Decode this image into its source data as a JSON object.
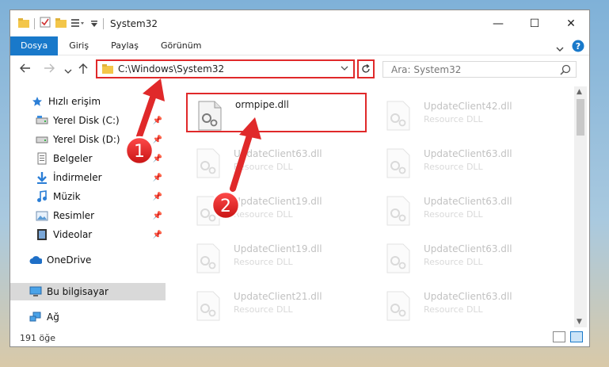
{
  "title_bar": {
    "title": "System32",
    "minimize": "—",
    "maximize": "☐",
    "close": "✕"
  },
  "ribbon": {
    "tabs": [
      "Dosya",
      "Giriş",
      "Paylaş",
      "Görünüm"
    ],
    "help": "?"
  },
  "address": {
    "path": "C:\\Windows\\System32",
    "search_placeholder": "Ara: System32"
  },
  "sidebar": {
    "items": [
      {
        "label": "Hızlı erişim",
        "icon": "star-icon",
        "pinned": false
      },
      {
        "label": "Yerel Disk (C:)",
        "icon": "drive-icon",
        "pinned": true
      },
      {
        "label": "Yerel Disk (D:)",
        "icon": "drive-icon",
        "pinned": true
      },
      {
        "label": "Belgeler",
        "icon": "documents-icon",
        "pinned": true
      },
      {
        "label": "İndirmeler",
        "icon": "download-icon",
        "pinned": true
      },
      {
        "label": "Müzik",
        "icon": "music-icon",
        "pinned": true
      },
      {
        "label": "Resimler",
        "icon": "pictures-icon",
        "pinned": true
      },
      {
        "label": "Videolar",
        "icon": "videos-icon",
        "pinned": true
      },
      {
        "label": "OneDrive",
        "icon": "cloud-icon",
        "pinned": false
      },
      {
        "label": "Bu bilgisayar",
        "icon": "computer-icon",
        "pinned": false,
        "selected": true
      },
      {
        "label": "Ağ",
        "icon": "network-icon",
        "pinned": false
      }
    ]
  },
  "files": [
    {
      "name": "ormpipe.dll",
      "type": "",
      "highlight": true
    },
    {
      "name": "UpdateClient42.dll",
      "type": "Resource DLL"
    },
    {
      "name": "UpdateClient63.dll",
      "type": "Resource DLL"
    },
    {
      "name": "UpdateClient63.dll",
      "type": "Resource DLL"
    },
    {
      "name": "UpdateClient19.dll",
      "type": "Resource DLL"
    },
    {
      "name": "UpdateClient63.dll",
      "type": "Resource DLL"
    },
    {
      "name": "UpdateClient19.dll",
      "type": "Resource DLL"
    },
    {
      "name": "UpdateClient63.dll",
      "type": "Resource DLL"
    },
    {
      "name": "UpdateClient21.dll",
      "type": "Resource DLL"
    },
    {
      "name": "UpdateClient63.dll",
      "type": "Resource DLL"
    }
  ],
  "status": {
    "item_count": "191 öğe"
  },
  "annotations": {
    "step1": "1",
    "step2": "2"
  },
  "colors": {
    "accent": "#1979ca",
    "highlight": "#e0292a"
  }
}
